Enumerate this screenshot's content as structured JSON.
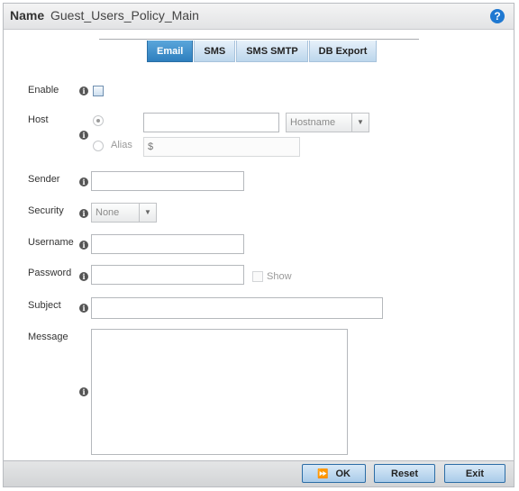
{
  "header": {
    "name_label": "Name",
    "name_value": "Guest_Users_Policy_Main",
    "help_icon": "?"
  },
  "tabs": [
    {
      "label": "Email",
      "active": true
    },
    {
      "label": "SMS",
      "active": false
    },
    {
      "label": "SMS SMTP",
      "active": false
    },
    {
      "label": "DB Export",
      "active": false
    }
  ],
  "form": {
    "enable": {
      "label": "Enable",
      "checked": false
    },
    "host": {
      "label": "Host",
      "value": "",
      "type_select": "Hostname",
      "alias_label": "Alias",
      "alias_placeholder": "$"
    },
    "sender": {
      "label": "Sender",
      "value": ""
    },
    "security": {
      "label": "Security",
      "selected": "None"
    },
    "username": {
      "label": "Username",
      "value": ""
    },
    "password": {
      "label": "Password",
      "value": "",
      "show_label": "Show"
    },
    "subject": {
      "label": "Subject",
      "value": ""
    },
    "message": {
      "label": "Message",
      "value": ""
    }
  },
  "footer": {
    "ok_label": "OK",
    "reset_label": "Reset",
    "exit_label": "Exit"
  },
  "info_glyph": "i"
}
